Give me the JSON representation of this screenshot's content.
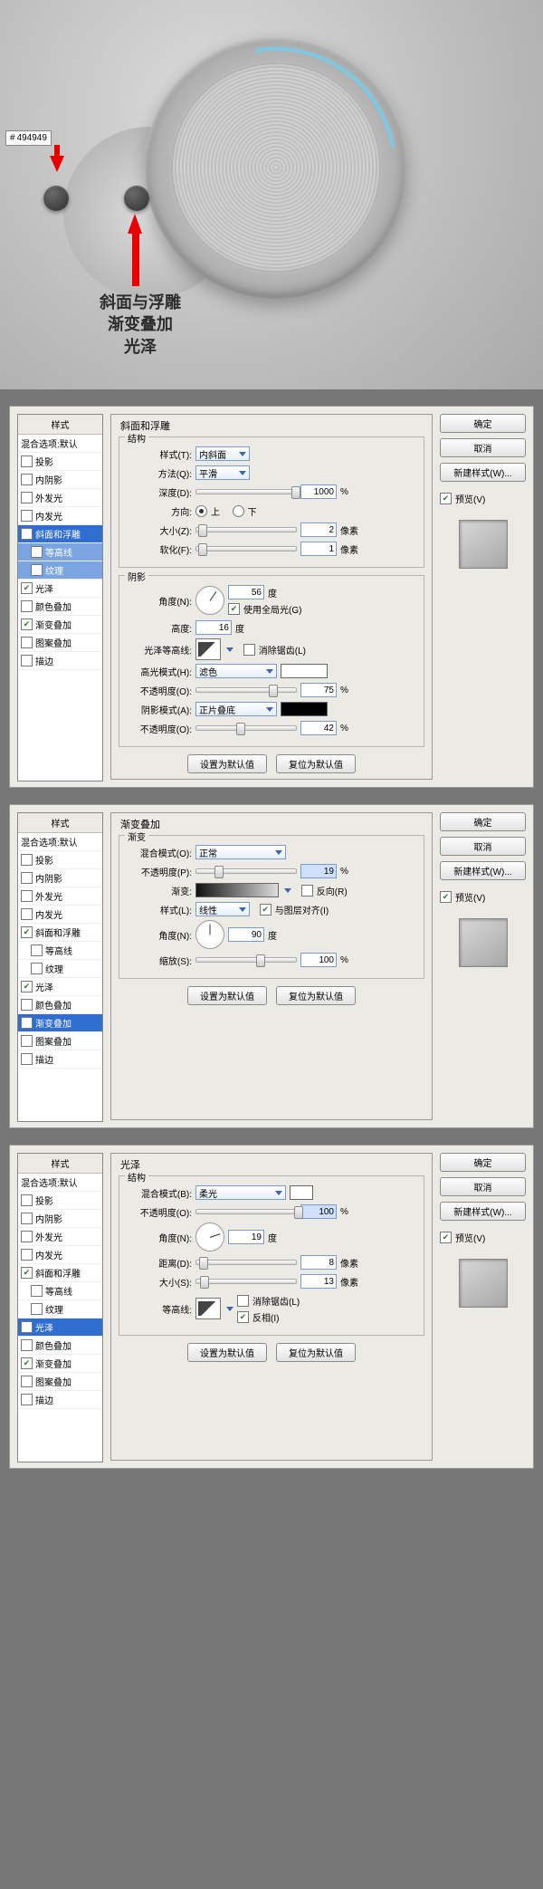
{
  "render": {
    "color_hex": "494949",
    "labels": [
      "斜面与浮雕",
      "渐变叠加",
      "光泽"
    ]
  },
  "common": {
    "styles_header": "样式",
    "blend_default": "混合选项:默认",
    "ok": "确定",
    "cancel": "取消",
    "new_style": "新建样式(W)...",
    "preview": "预览(V)",
    "set_default": "设置为默认值",
    "reset_default": "复位为默认值"
  },
  "styles": [
    {
      "key": "drop",
      "label": "投影"
    },
    {
      "key": "inner_shadow",
      "label": "内阴影"
    },
    {
      "key": "outer_glow",
      "label": "外发光"
    },
    {
      "key": "inner_glow",
      "label": "内发光"
    },
    {
      "key": "bevel",
      "label": "斜面和浮雕"
    },
    {
      "key": "contour",
      "label": "等高线",
      "child": true
    },
    {
      "key": "texture",
      "label": "纹理",
      "child": true
    },
    {
      "key": "satin",
      "label": "光泽"
    },
    {
      "key": "color_overlay",
      "label": "颜色叠加"
    },
    {
      "key": "grad_overlay",
      "label": "渐变叠加"
    },
    {
      "key": "pattern_overlay",
      "label": "图案叠加"
    },
    {
      "key": "stroke",
      "label": "描边"
    }
  ],
  "panel1": {
    "title": "斜面和浮雕",
    "structure": "结构",
    "style_l": "样式(T):",
    "style_v": "内斜面",
    "method_l": "方法(Q):",
    "method_v": "平滑",
    "depth_l": "深度(D):",
    "depth_v": "1000",
    "pct": "%",
    "dir_l": "方向:",
    "up": "上",
    "down": "下",
    "size_l": "大小(Z):",
    "size_v": "2",
    "px": "像素",
    "soften_l": "软化(F):",
    "soften_v": "1",
    "shading": "阴影",
    "angle_l": "角度(N):",
    "angle_v": "56",
    "deg": "度",
    "global": "使用全局光(G)",
    "alt_l": "高度:",
    "alt_v": "16",
    "gloss_l": "光泽等高线:",
    "anti": "消除锯齿(L)",
    "hi_mode_l": "高光模式(H):",
    "hi_mode_v": "滤色",
    "opacity_l": "不透明度(O):",
    "hi_op_v": "75",
    "sh_mode_l": "阴影模式(A):",
    "sh_mode_v": "正片叠底",
    "sh_op_v": "42"
  },
  "panel2": {
    "title": "渐变叠加",
    "grad": "渐变",
    "blend_l": "混合模式(O):",
    "blend_v": "正常",
    "opacity_l": "不透明度(P):",
    "opacity_v": "19",
    "pct": "%",
    "grad_l": "渐变:",
    "reverse": "反向(R)",
    "style_l": "样式(L):",
    "style_v": "线性",
    "align": "与图层对齐(I)",
    "angle_l": "角度(N):",
    "angle_v": "90",
    "deg": "度",
    "scale_l": "缩放(S):",
    "scale_v": "100"
  },
  "panel3": {
    "title": "光泽",
    "structure": "结构",
    "blend_l": "混合模式(B):",
    "blend_v": "柔光",
    "opacity_l": "不透明度(O):",
    "opacity_v": "100",
    "pct": "%",
    "angle_l": "角度(N):",
    "angle_v": "19",
    "deg": "度",
    "dist_l": "距离(D):",
    "dist_v": "8",
    "px": "像素",
    "size_l": "大小(S):",
    "size_v": "13",
    "contour_l": "等高线:",
    "anti": "消除锯齿(L)",
    "invert": "反相(I)"
  }
}
